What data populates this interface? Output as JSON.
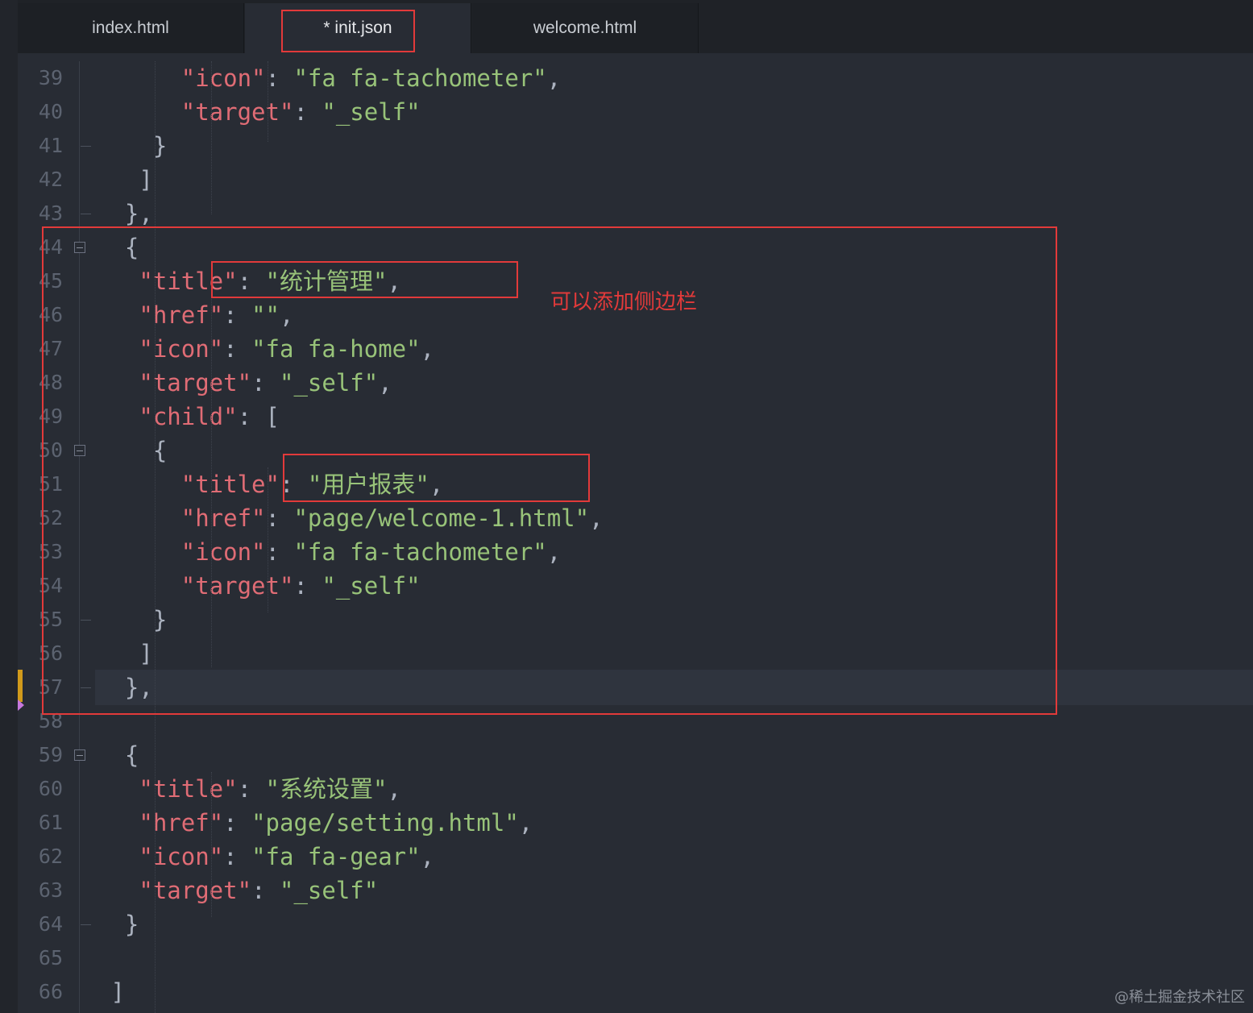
{
  "tabs": [
    {
      "label": "index.html",
      "active": false
    },
    {
      "label": "* init.json",
      "active": true
    },
    {
      "label": "welcome.html",
      "active": false
    }
  ],
  "lines": [
    {
      "num": "39",
      "parts": [
        {
          "t": "      \"icon\"",
          "c": "k"
        },
        {
          "t": ": ",
          "c": "p"
        },
        {
          "t": "\"fa fa-tachometer\"",
          "c": "s"
        },
        {
          "t": ",",
          "c": "p"
        }
      ]
    },
    {
      "num": "40",
      "parts": [
        {
          "t": "      \"target\"",
          "c": "k"
        },
        {
          "t": ": ",
          "c": "p"
        },
        {
          "t": "\"_self\"",
          "c": "s"
        }
      ]
    },
    {
      "num": "41",
      "parts": [
        {
          "t": "    }",
          "c": "p"
        }
      ]
    },
    {
      "num": "42",
      "parts": [
        {
          "t": "   ]",
          "c": "p"
        }
      ]
    },
    {
      "num": "43",
      "parts": [
        {
          "t": "  },",
          "c": "p"
        }
      ]
    },
    {
      "num": "44",
      "parts": [
        {
          "t": "  {",
          "c": "p"
        }
      ]
    },
    {
      "num": "45",
      "parts": [
        {
          "t": "   \"title\"",
          "c": "k"
        },
        {
          "t": ": ",
          "c": "p"
        },
        {
          "t": "\"统计管理\"",
          "c": "s"
        },
        {
          "t": ",",
          "c": "p"
        }
      ]
    },
    {
      "num": "46",
      "parts": [
        {
          "t": "   \"href\"",
          "c": "k"
        },
        {
          "t": ": ",
          "c": "p"
        },
        {
          "t": "\"\"",
          "c": "s"
        },
        {
          "t": ",",
          "c": "p"
        }
      ]
    },
    {
      "num": "47",
      "parts": [
        {
          "t": "   \"icon\"",
          "c": "k"
        },
        {
          "t": ": ",
          "c": "p"
        },
        {
          "t": "\"fa fa-home\"",
          "c": "s"
        },
        {
          "t": ",",
          "c": "p"
        }
      ]
    },
    {
      "num": "48",
      "parts": [
        {
          "t": "   \"target\"",
          "c": "k"
        },
        {
          "t": ": ",
          "c": "p"
        },
        {
          "t": "\"_self\"",
          "c": "s"
        },
        {
          "t": ",",
          "c": "p"
        }
      ]
    },
    {
      "num": "49",
      "parts": [
        {
          "t": "   \"child\"",
          "c": "k"
        },
        {
          "t": ": [",
          "c": "p"
        }
      ]
    },
    {
      "num": "50",
      "parts": [
        {
          "t": "    {",
          "c": "p"
        }
      ]
    },
    {
      "num": "51",
      "parts": [
        {
          "t": "      \"title\"",
          "c": "k"
        },
        {
          "t": ": ",
          "c": "p"
        },
        {
          "t": "\"用户报表\"",
          "c": "s"
        },
        {
          "t": ",",
          "c": "p"
        }
      ]
    },
    {
      "num": "52",
      "parts": [
        {
          "t": "      \"href\"",
          "c": "k"
        },
        {
          "t": ": ",
          "c": "p"
        },
        {
          "t": "\"page/welcome-1.html\"",
          "c": "s"
        },
        {
          "t": ",",
          "c": "p"
        }
      ]
    },
    {
      "num": "53",
      "parts": [
        {
          "t": "      \"icon\"",
          "c": "k"
        },
        {
          "t": ": ",
          "c": "p"
        },
        {
          "t": "\"fa fa-tachometer\"",
          "c": "s"
        },
        {
          "t": ",",
          "c": "p"
        }
      ]
    },
    {
      "num": "54",
      "parts": [
        {
          "t": "      \"target\"",
          "c": "k"
        },
        {
          "t": ": ",
          "c": "p"
        },
        {
          "t": "\"_self\"",
          "c": "s"
        }
      ]
    },
    {
      "num": "55",
      "parts": [
        {
          "t": "    }",
          "c": "p"
        }
      ]
    },
    {
      "num": "56",
      "parts": [
        {
          "t": "   ]",
          "c": "p"
        }
      ]
    },
    {
      "num": "57",
      "parts": [
        {
          "t": "  },",
          "c": "p"
        }
      ]
    },
    {
      "num": "58",
      "parts": []
    },
    {
      "num": "59",
      "parts": [
        {
          "t": "  {",
          "c": "p"
        }
      ]
    },
    {
      "num": "60",
      "parts": [
        {
          "t": "   \"title\"",
          "c": "k"
        },
        {
          "t": ": ",
          "c": "p"
        },
        {
          "t": "\"系统设置\"",
          "c": "s"
        },
        {
          "t": ",",
          "c": "p"
        }
      ]
    },
    {
      "num": "61",
      "parts": [
        {
          "t": "   \"href\"",
          "c": "k"
        },
        {
          "t": ": ",
          "c": "p"
        },
        {
          "t": "\"page/setting.html\"",
          "c": "s"
        },
        {
          "t": ",",
          "c": "p"
        }
      ]
    },
    {
      "num": "62",
      "parts": [
        {
          "t": "   \"icon\"",
          "c": "k"
        },
        {
          "t": ": ",
          "c": "p"
        },
        {
          "t": "\"fa fa-gear\"",
          "c": "s"
        },
        {
          "t": ",",
          "c": "p"
        }
      ]
    },
    {
      "num": "63",
      "parts": [
        {
          "t": "   \"target\"",
          "c": "k"
        },
        {
          "t": ": ",
          "c": "p"
        },
        {
          "t": "\"_self\"",
          "c": "s"
        }
      ]
    },
    {
      "num": "64",
      "parts": [
        {
          "t": "  }",
          "c": "p"
        }
      ]
    },
    {
      "num": "65",
      "parts": []
    },
    {
      "num": "66",
      "parts": [
        {
          "t": " ]",
          "c": "p"
        }
      ]
    }
  ],
  "annotation": "可以添加侧边栏",
  "watermark": "@稀土掘金技术社区",
  "colors": {
    "key": "#e06c75",
    "string": "#98c379",
    "punct": "#abb2bf",
    "highlight_box": "#e23a3a",
    "background": "#282c34"
  }
}
